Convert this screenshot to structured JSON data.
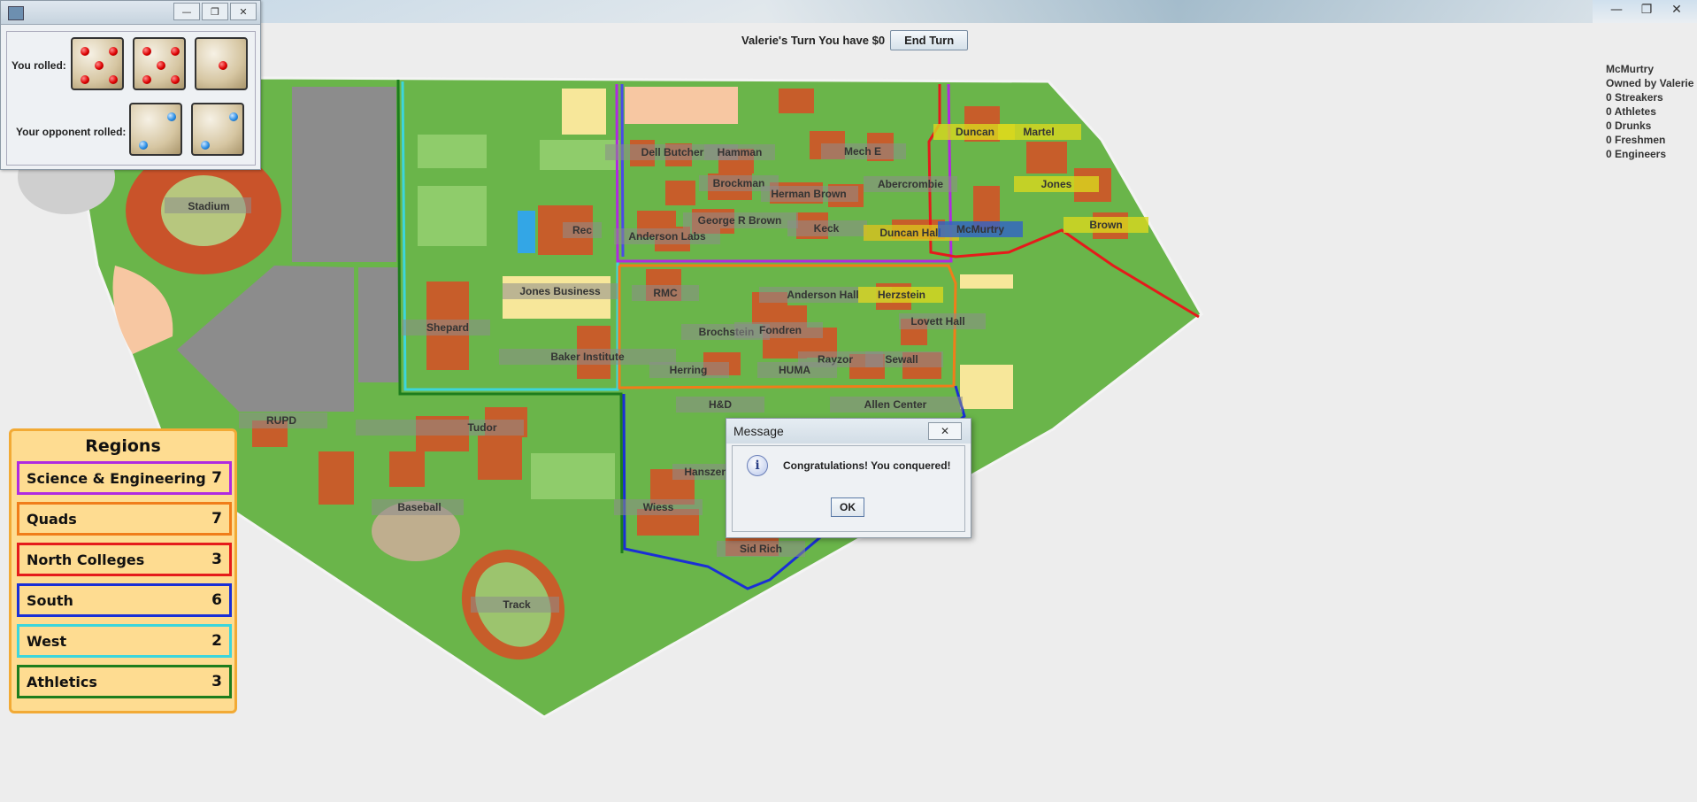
{
  "window": {
    "minimize_label": "—",
    "maximize_label": "❐",
    "close_label": "✕"
  },
  "topbar": {
    "turn_text": "Valerie's Turn  You have $0",
    "end_turn_label": "End Turn"
  },
  "dice_window": {
    "you_rolled_label": "You rolled:",
    "opponent_rolled_label": "Your opponent rolled:",
    "you_rolled_values": [
      5,
      5,
      1
    ],
    "opponent_rolled_values": [
      2,
      2
    ]
  },
  "info_panel": {
    "territory": "McMurtry",
    "owner": "Owned by Valerie",
    "streakers": "0 Streakers",
    "athletes": "0 Athletes",
    "drunks": "0 Drunks",
    "freshmen": "0 Freshmen",
    "engineers": "0 Engineers"
  },
  "regions": {
    "title": "Regions",
    "items": [
      {
        "name": "Science & Engineering",
        "value": "7",
        "color": "#b02ae0"
      },
      {
        "name": "Quads",
        "value": "7",
        "color": "#f07d1a"
      },
      {
        "name": "North Colleges",
        "value": "3",
        "color": "#e51b1b"
      },
      {
        "name": "South",
        "value": "6",
        "color": "#1a2fd6"
      },
      {
        "name": "West",
        "value": "2",
        "color": "#3cd6dc"
      },
      {
        "name": "Athletics",
        "value": "3",
        "color": "#1d7d1d"
      }
    ]
  },
  "map_labels": {
    "stadium": "Stadium",
    "rec": "Rec",
    "jones_business": "Jones Business",
    "shepard": "Shepard",
    "baker_institute": "Baker Institute",
    "rupd": "RUPD",
    "tudor": "Tudor",
    "baseball": "Baseball",
    "track": "Track",
    "dell_butcher": "Dell Butcher",
    "hamman": "Hamman",
    "mech_e": "Mech E",
    "brockman": "Brockman",
    "herman_brown": "Herman Brown",
    "abercrombie": "Abercrombie",
    "george_r_brown": "George R Brown",
    "anderson_labs": "Anderson Labs",
    "keck": "Keck",
    "duncan_hall": "Duncan Hall",
    "mcmurtry": "McMurtry",
    "duncan": "Duncan",
    "martel": "Martel",
    "jones": "Jones",
    "brown": "Brown",
    "rmc": "RMC",
    "anderson_hall": "Anderson Hall",
    "herzstein": "Herzstein",
    "lovett_hall": "Lovett Hall",
    "brochstein": "Brochstein",
    "fondren": "Fondren",
    "rayzor": "Rayzor",
    "sewall": "Sewall",
    "herring": "Herring",
    "humanities": "HUMA",
    "hnd": "H&D",
    "allen_center": "Allen Center",
    "hanszen": "Hanszen",
    "wiess": "Wiess",
    "sid_rich": "Sid Rich"
  },
  "message_dialog": {
    "title": "Message",
    "close_label": "✕",
    "icon": "i",
    "text": "Congratulations! You conquered!",
    "ok_label": "OK"
  }
}
